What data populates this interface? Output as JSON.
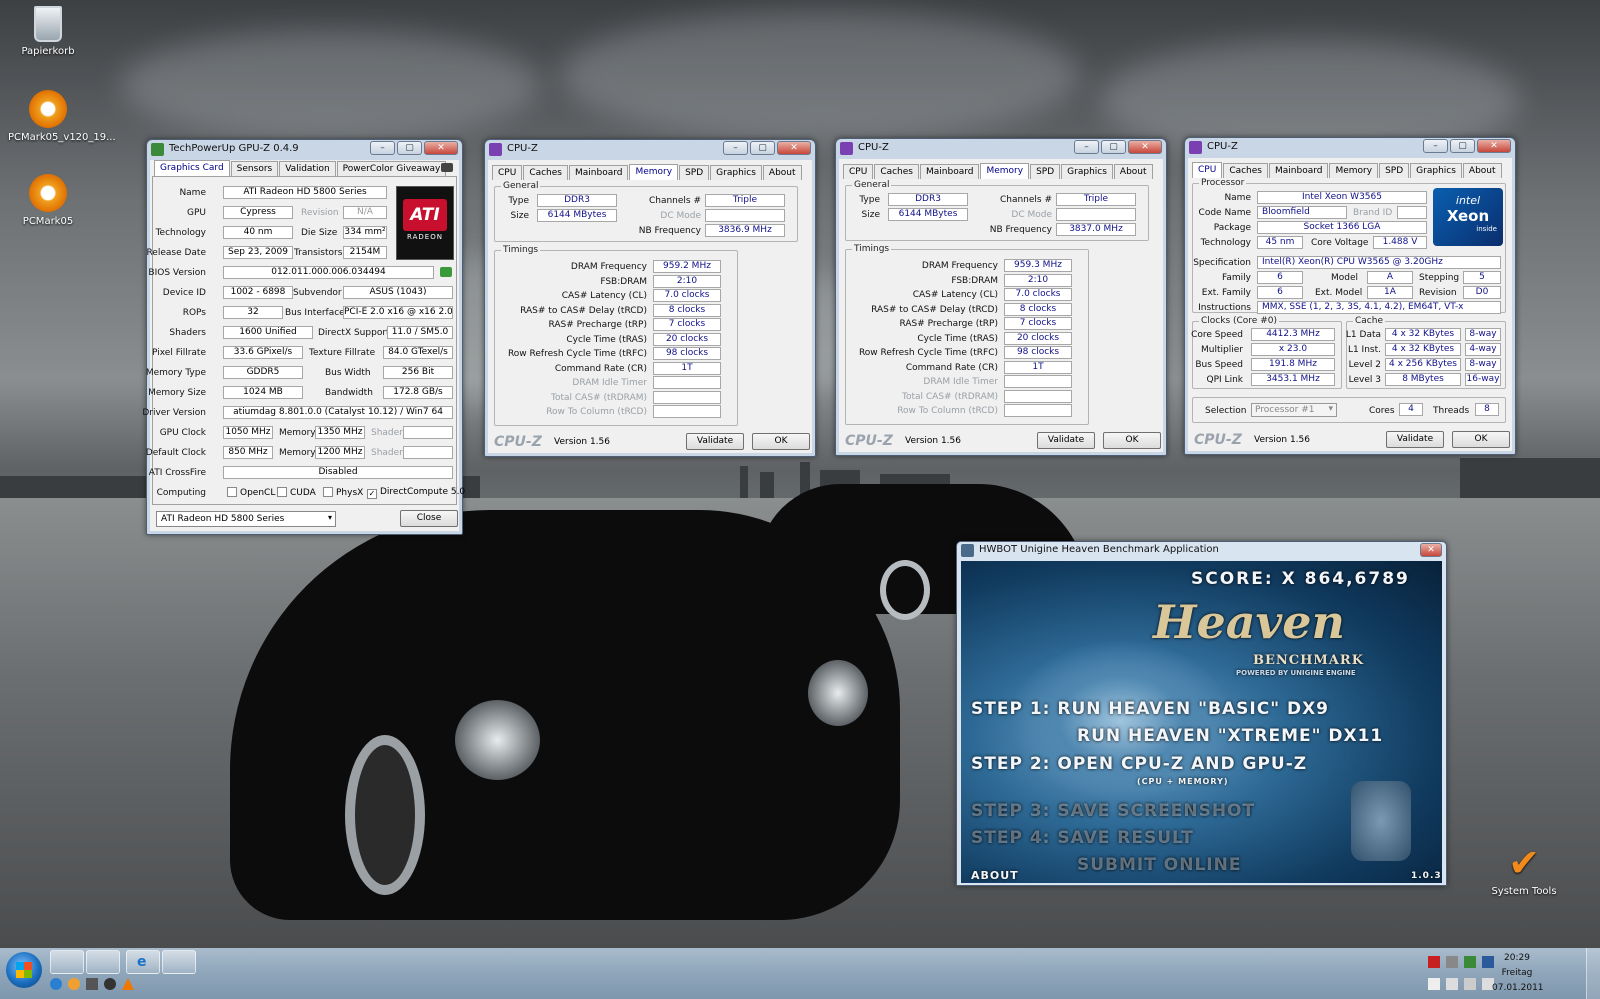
{
  "desktop": {
    "icons": [
      {
        "label": "Papierkorb",
        "icon": "recycle-bin-icon"
      },
      {
        "label": "PCMark05_v120_19...",
        "icon": "pcmark-icon"
      },
      {
        "label": "PCMark05",
        "icon": "pcmark-shortcut-icon"
      }
    ],
    "gadget_label": "System Tools"
  },
  "gpuz": {
    "title": "TechPowerUp GPU-Z 0.4.9",
    "tabs": [
      "Graphics Card",
      "Sensors",
      "Validation",
      "PowerColor Giveaway"
    ],
    "fields": {
      "name_lbl": "Name",
      "name": "ATI Radeon HD 5800 Series",
      "gpu_lbl": "GPU",
      "gpu": "Cypress",
      "revision_lbl": "Revision",
      "revision": "N/A",
      "technology_lbl": "Technology",
      "technology": "40 nm",
      "die_size_lbl": "Die Size",
      "die_size": "334 mm²",
      "release_lbl": "Release Date",
      "release": "Sep 23, 2009",
      "transistors_lbl": "Transistors",
      "transistors": "2154M",
      "bios_lbl": "BIOS Version",
      "bios": "012.011.000.006.034494",
      "device_lbl": "Device ID",
      "device": "1002 - 6898",
      "subvendor_lbl": "Subvendor",
      "subvendor": "ASUS (1043)",
      "rops_lbl": "ROPs",
      "rops": "32",
      "bus_lbl": "Bus Interface",
      "bus": "PCI-E 2.0 x16 @ x16 2.0",
      "shaders_lbl": "Shaders",
      "shaders": "1600 Unified",
      "directx_lbl": "DirectX Support",
      "directx": "11.0 / SM5.0",
      "pixel_lbl": "Pixel Fillrate",
      "pixel": "33.6 GPixel/s",
      "texture_lbl": "Texture Fillrate",
      "texture": "84.0 GTexel/s",
      "memtype_lbl": "Memory Type",
      "memtype": "GDDR5",
      "buswidth_lbl": "Bus Width",
      "buswidth": "256 Bit",
      "memsize_lbl": "Memory Size",
      "memsize": "1024 MB",
      "bandwidth_lbl": "Bandwidth",
      "bandwidth": "172.8 GB/s",
      "driver_lbl": "Driver Version",
      "driver": "atiumdag 8.801.0.0 (Catalyst 10.12) / Win7 64",
      "gpuclock_lbl": "GPU Clock",
      "gpuclock": "1050 MHz",
      "memory_lbl": "Memory",
      "memclock": "1350 MHz",
      "shader_lbl": "Shader",
      "shaderclock": "",
      "defclock_lbl": "Default Clock",
      "defclock": "850 MHz",
      "defmem": "1200 MHz",
      "crossfire_lbl": "ATI CrossFire",
      "crossfire": "Disabled",
      "computing_lbl": "Computing",
      "opencl": "OpenCL",
      "cuda": "CUDA",
      "physx": "PhysX",
      "dc": "DirectCompute 5.0"
    },
    "selector": "ATI Radeon HD 5800 Series",
    "close_label": "Close",
    "logo_text": "ATI",
    "logo_sub": "RADEON"
  },
  "cpuz_mem": [
    {
      "title": "CPU-Z",
      "tabs": [
        "CPU",
        "Caches",
        "Mainboard",
        "Memory",
        "SPD",
        "Graphics",
        "About"
      ],
      "general_lbl": "General",
      "type_lbl": "Type",
      "type": "DDR3",
      "size_lbl": "Size",
      "size": "6144 MBytes",
      "channels_lbl": "Channels #",
      "channels": "Triple",
      "dcmode_lbl": "DC Mode",
      "nbfreq_lbl": "NB Frequency",
      "nbfreq": "3836.9 MHz",
      "timings_lbl": "Timings",
      "timings": [
        {
          "l": "DRAM Frequency",
          "v": "959.2 MHz"
        },
        {
          "l": "FSB:DRAM",
          "v": "2:10"
        },
        {
          "l": "CAS# Latency (CL)",
          "v": "7.0 clocks"
        },
        {
          "l": "RAS# to CAS# Delay (tRCD)",
          "v": "8 clocks"
        },
        {
          "l": "RAS# Precharge (tRP)",
          "v": "7 clocks"
        },
        {
          "l": "Cycle Time (tRAS)",
          "v": "20 clocks"
        },
        {
          "l": "Row Refresh Cycle Time (tRFC)",
          "v": "98 clocks"
        },
        {
          "l": "Command Rate (CR)",
          "v": "1T"
        },
        {
          "l": "DRAM Idle Timer",
          "v": ""
        },
        {
          "l": "Total CAS# (tRDRAM)",
          "v": ""
        },
        {
          "l": "Row To Column (tRCD)",
          "v": ""
        }
      ],
      "logo": "CPU-Z",
      "version": "Version 1.56",
      "validate": "Validate",
      "ok": "OK"
    },
    {
      "title": "CPU-Z",
      "tabs": [
        "CPU",
        "Caches",
        "Mainboard",
        "Memory",
        "SPD",
        "Graphics",
        "About"
      ],
      "general_lbl": "General",
      "type_lbl": "Type",
      "type": "DDR3",
      "size_lbl": "Size",
      "size": "6144 MBytes",
      "channels_lbl": "Channels #",
      "channels": "Triple",
      "dcmode_lbl": "DC Mode",
      "nbfreq_lbl": "NB Frequency",
      "nbfreq": "3837.0 MHz",
      "timings_lbl": "Timings",
      "timings": [
        {
          "l": "DRAM Frequency",
          "v": "959.3 MHz"
        },
        {
          "l": "FSB:DRAM",
          "v": "2:10"
        },
        {
          "l": "CAS# Latency (CL)",
          "v": "7.0 clocks"
        },
        {
          "l": "RAS# to CAS# Delay (tRCD)",
          "v": "8 clocks"
        },
        {
          "l": "RAS# Precharge (tRP)",
          "v": "7 clocks"
        },
        {
          "l": "Cycle Time (tRAS)",
          "v": "20 clocks"
        },
        {
          "l": "Row Refresh Cycle Time (tRFC)",
          "v": "98 clocks"
        },
        {
          "l": "Command Rate (CR)",
          "v": "1T"
        },
        {
          "l": "DRAM Idle Timer",
          "v": ""
        },
        {
          "l": "Total CAS# (tRDRAM)",
          "v": ""
        },
        {
          "l": "Row To Column (tRCD)",
          "v": ""
        }
      ],
      "logo": "CPU-Z",
      "version": "Version 1.56",
      "validate": "Validate",
      "ok": "OK"
    }
  ],
  "cpuz_cpu": {
    "title": "CPU-Z",
    "tabs": [
      "CPU",
      "Caches",
      "Mainboard",
      "Memory",
      "SPD",
      "Graphics",
      "About"
    ],
    "processor_lbl": "Processor",
    "name_lbl": "Name",
    "name": "Intel Xeon W3565",
    "codename_lbl": "Code Name",
    "codename": "Bloomfield",
    "brandid_lbl": "Brand ID",
    "package_lbl": "Package",
    "package": "Socket 1366 LGA",
    "technology_lbl": "Technology",
    "technology": "45 nm",
    "corevolt_lbl": "Core Voltage",
    "corevolt": "1.488 V",
    "spec_lbl": "Specification",
    "spec": "Intel(R) Xeon(R) CPU      W3565  @ 3.20GHz",
    "family_lbl": "Family",
    "family": "6",
    "model_lbl": "Model",
    "model": "A",
    "stepping_lbl": "Stepping",
    "stepping": "5",
    "extfamily_lbl": "Ext. Family",
    "extfamily": "6",
    "extmodel_lbl": "Ext. Model",
    "extmodel": "1A",
    "revision_lbl": "Revision",
    "revision": "D0",
    "instr_lbl": "Instructions",
    "instr": "MMX, SSE (1, 2, 3, 3S, 4.1, 4.2), EM64T, VT-x",
    "clocks_lbl": "Clocks (Core #0)",
    "corespeed_lbl": "Core Speed",
    "corespeed": "4412.3 MHz",
    "multiplier_lbl": "Multiplier",
    "multiplier": "x 23.0",
    "busspeed_lbl": "Bus Speed",
    "busspeed": "191.8 MHz",
    "qpi_lbl": "QPI Link",
    "qpi": "3453.1 MHz",
    "cache_lbl": "Cache",
    "l1d_lbl": "L1 Data",
    "l1d": "4 x 32 KBytes",
    "l1d_way": "8-way",
    "l1i_lbl": "L1 Inst.",
    "l1i": "4 x 32 KBytes",
    "l1i_way": "4-way",
    "l2_lbl": "Level 2",
    "l2": "4 x 256 KBytes",
    "l2_way": "8-way",
    "l3_lbl": "Level 3",
    "l3": "8 MBytes",
    "l3_way": "16-way",
    "selection_lbl": "Selection",
    "selection": "Processor #1",
    "cores_lbl": "Cores",
    "cores": "4",
    "threads_lbl": "Threads",
    "threads": "8",
    "intel_logo": "intel",
    "xeon": "Xeon",
    "inside": "inside",
    "logo": "CPU-Z",
    "version": "Version 1.56",
    "validate": "Validate",
    "ok": "OK"
  },
  "heaven": {
    "title": "HWBOT Unigine Heaven Benchmark Application",
    "score": "SCORE: X 864,6789",
    "brand": "Heaven",
    "benchmark": "BENCHMARK",
    "powered": "POWERED BY UNIGINE ENGINE",
    "step1": "STEP 1:  RUN HEAVEN \"BASIC\" DX9",
    "step1b": "RUN HEAVEN \"XTREME\" DX11",
    "step2": "STEP 2: OPEN CPU-Z   AND   GPU-Z",
    "step2b": "(CPU + MEMORY)",
    "step3": "STEP 3: SAVE SCREENSHOT",
    "step4": "STEP 4: SAVE RESULT",
    "submit": "SUBMIT ONLINE",
    "about": "ABOUT",
    "version": "1.0.3"
  },
  "taskbar": {
    "time": "20:29",
    "day": "Freitag",
    "date": "07.01.2011"
  }
}
